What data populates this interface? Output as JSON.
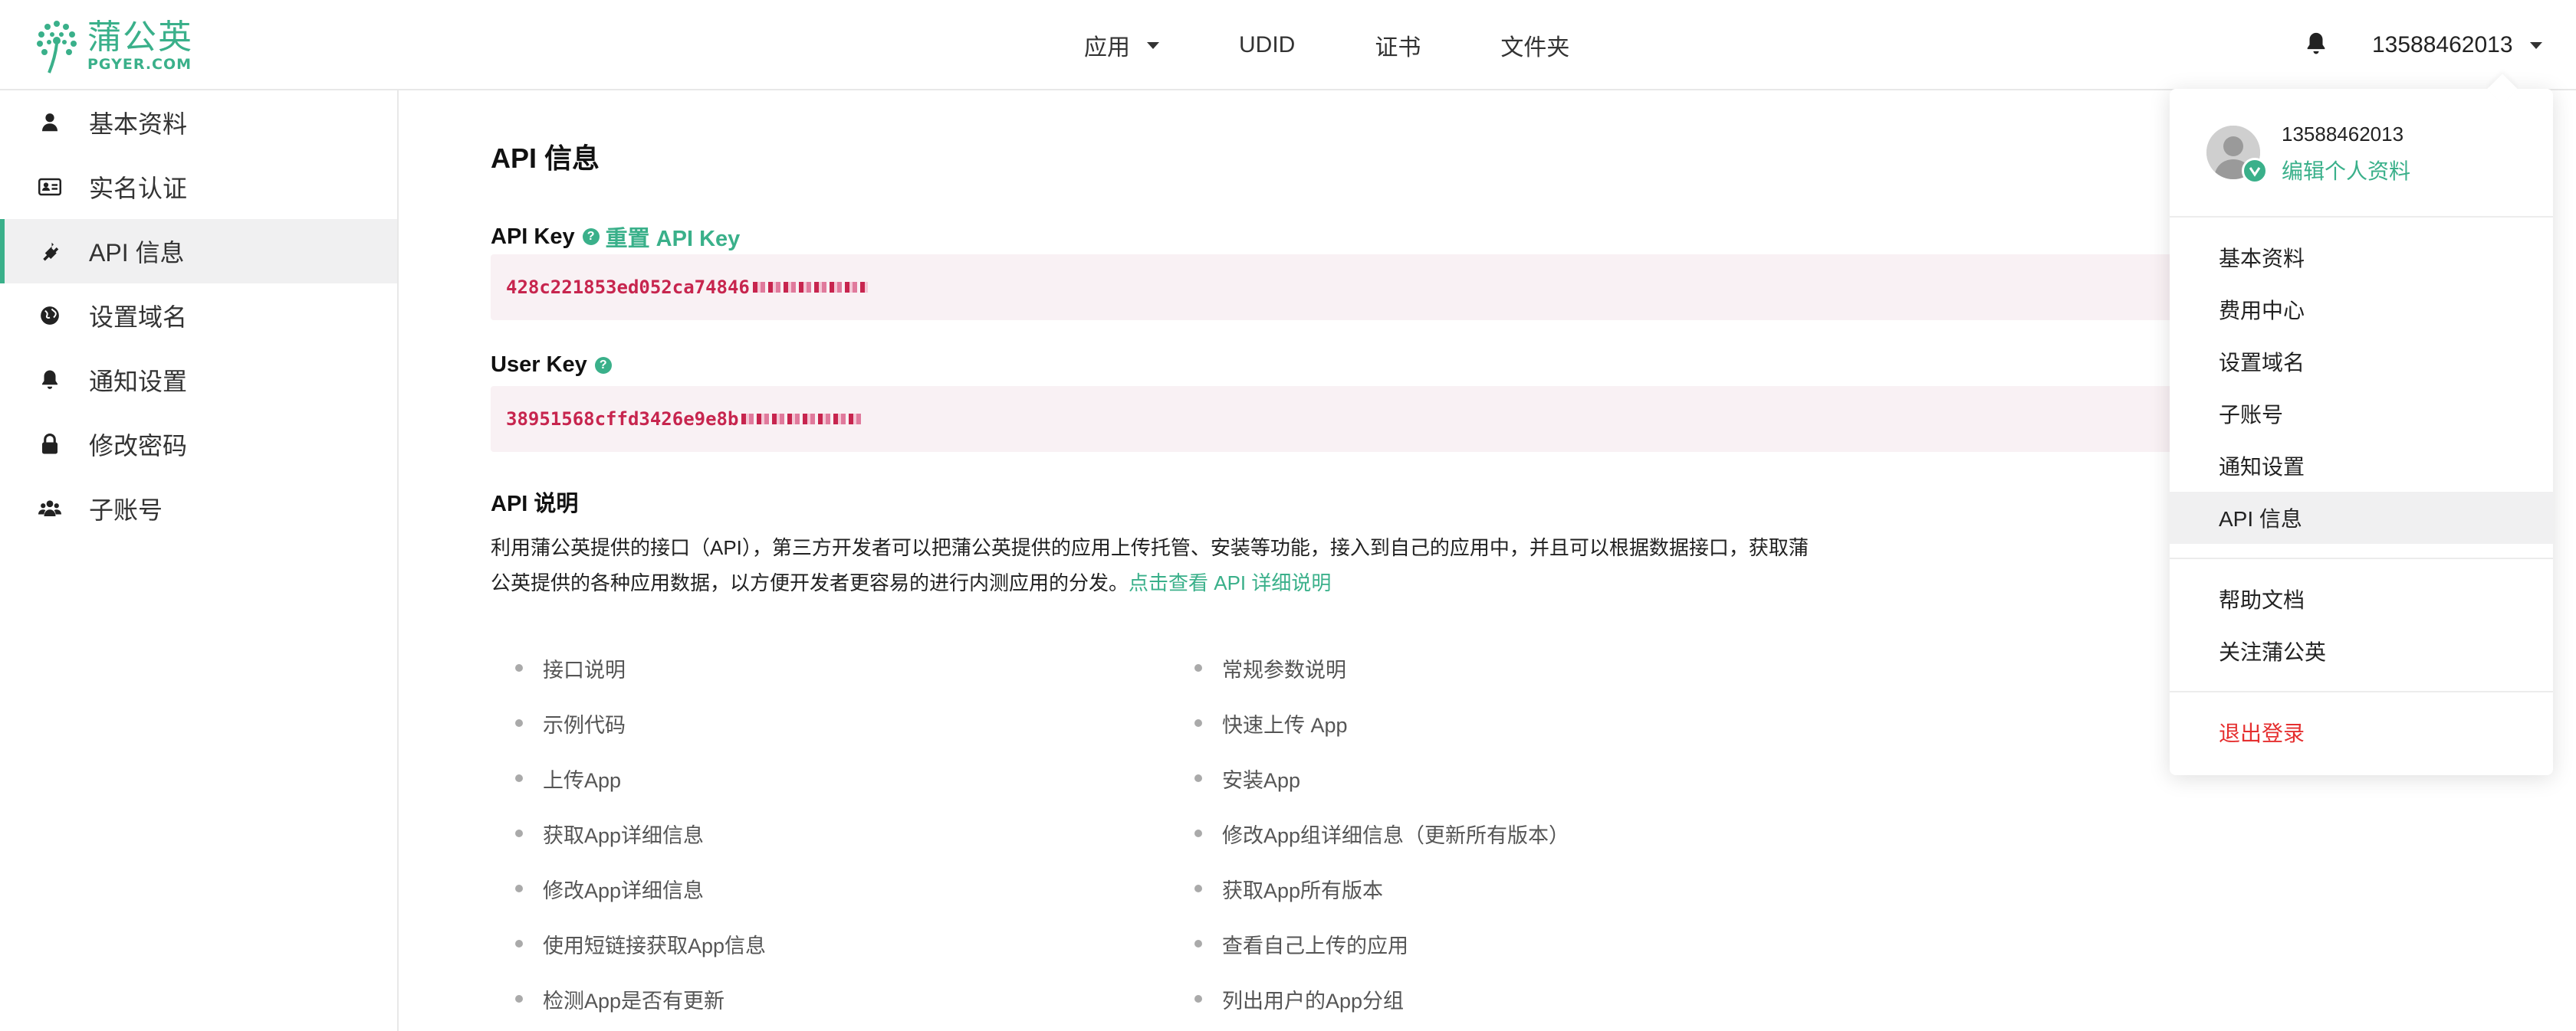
{
  "brand": {
    "name_cn": "蒲公英",
    "name_en": "PGYER.COM",
    "color": "#3ab08a"
  },
  "topnav": {
    "items": [
      {
        "label": "应用",
        "has_dropdown": true
      },
      {
        "label": "UDID",
        "has_dropdown": false
      },
      {
        "label": "证书",
        "has_dropdown": false
      },
      {
        "label": "文件夹",
        "has_dropdown": false
      }
    ],
    "bell_icon": "bell-icon",
    "user_phone": "13588462013"
  },
  "sidebar": {
    "items": [
      {
        "label": "基本资料",
        "icon": "user-icon"
      },
      {
        "label": "实名认证",
        "icon": "id-card-icon"
      },
      {
        "label": "API 信息",
        "icon": "plug-icon",
        "active": true
      },
      {
        "label": "设置域名",
        "icon": "globe-icon"
      },
      {
        "label": "通知设置",
        "icon": "bell-icon"
      },
      {
        "label": "修改密码",
        "icon": "lock-icon"
      },
      {
        "label": "子账号",
        "icon": "users-icon"
      }
    ]
  },
  "main": {
    "title": "API 信息",
    "api_key": {
      "label": "API Key",
      "reset_label": "重置 API Key",
      "value": "428c221853ed052ca74846"
    },
    "user_key": {
      "label": "User Key",
      "value": "38951568cffd3426e9e8b"
    },
    "section_title": "API 说明",
    "description": "利用蒲公英提供的接口（API），第三方开发者可以把蒲公英提供的应用上传托管、安装等功能，接入到自己的应用中，并且可以根据数据接口，获取蒲公英提供的各种应用数据，以方便开发者更容易的进行内测应用的分发。",
    "description_link": "点击查看 API 详细说明",
    "docs_left": [
      "接口说明",
      "示例代码",
      "上传App",
      "获取App详细信息",
      "修改App详细信息",
      "使用短链接获取App信息",
      "检测App是否有更新"
    ],
    "docs_right": [
      "常规参数说明",
      "快速上传 App",
      "安装App",
      "修改App组详细信息（更新所有版本）",
      "获取App所有版本",
      "查看自己上传的应用",
      "列出用户的App分组"
    ]
  },
  "dropdown": {
    "phone": "13588462013",
    "edit_profile": "编辑个人资料",
    "group1": [
      "基本资料",
      "费用中心",
      "设置域名",
      "子账号",
      "通知设置",
      "API 信息"
    ],
    "group1_active": "API 信息",
    "group2": [
      "帮助文档",
      "关注蒲公英"
    ],
    "logout": "退出登录",
    "logout_color": "#e52f2f"
  },
  "key_text_color": "#c7254e",
  "key_bg_color": "#f9f1f4"
}
